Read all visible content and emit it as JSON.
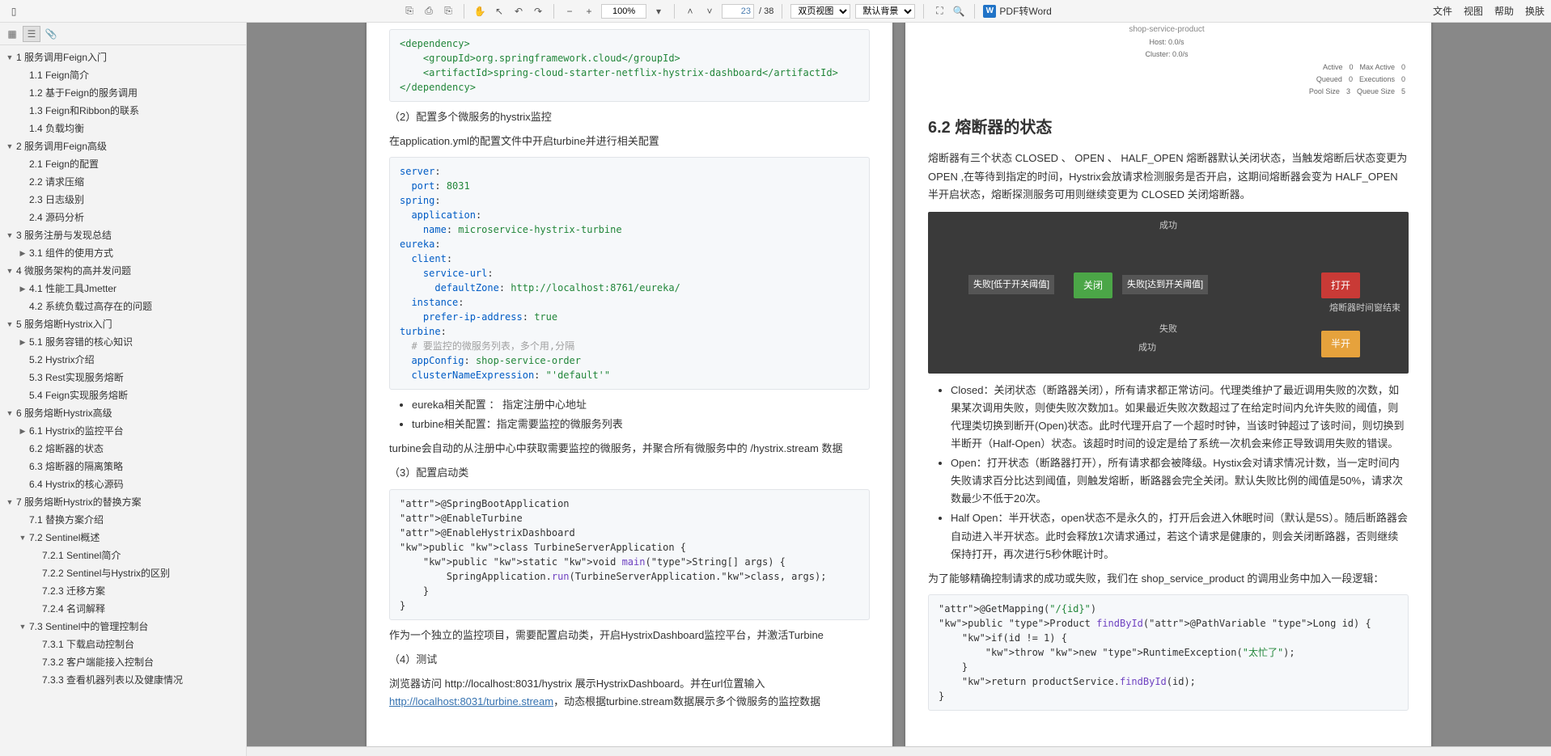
{
  "toolbar": {
    "page_current": "23",
    "page_total": "/ 38",
    "zoom": "100%",
    "spread_mode": "双页视图",
    "background_mode": "默认背景",
    "pdf_to_word": "PDF转Word",
    "pdf_icon": "W"
  },
  "menus": {
    "file": "文件",
    "view": "视图",
    "help": "帮助",
    "export": "换肤"
  },
  "outline": [
    {
      "lvl": 1,
      "toggle": "▼",
      "label": "1 服务调用Feign入门"
    },
    {
      "lvl": 2,
      "label": "1.1 Feign简介"
    },
    {
      "lvl": 2,
      "label": "1.2 基于Feign的服务调用"
    },
    {
      "lvl": 2,
      "label": "1.3 Feign和Ribbon的联系"
    },
    {
      "lvl": 2,
      "label": "1.4 负载均衡"
    },
    {
      "lvl": 1,
      "toggle": "▼",
      "label": "2 服务调用Feign高级"
    },
    {
      "lvl": 2,
      "label": "2.1 Feign的配置"
    },
    {
      "lvl": 2,
      "label": "2.2 请求压缩"
    },
    {
      "lvl": 2,
      "label": "2.3 日志级别"
    },
    {
      "lvl": 2,
      "label": "2.4 源码分析"
    },
    {
      "lvl": 1,
      "toggle": "▼",
      "label": "3 服务注册与发现总结"
    },
    {
      "lvl": 2,
      "toggle": "▶",
      "label": "3.1 组件的使用方式"
    },
    {
      "lvl": 1,
      "toggle": "▼",
      "label": "4 微服务架构的高并发问题"
    },
    {
      "lvl": 2,
      "toggle": "▶",
      "label": "4.1 性能工具Jmetter"
    },
    {
      "lvl": 2,
      "label": "4.2 系统负载过高存在的问题"
    },
    {
      "lvl": 1,
      "toggle": "▼",
      "label": "5 服务熔断Hystrix入门"
    },
    {
      "lvl": 2,
      "toggle": "▶",
      "label": "5.1 服务容错的核心知识"
    },
    {
      "lvl": 2,
      "label": "5.2 Hystrix介绍"
    },
    {
      "lvl": 2,
      "label": "5.3 Rest实现服务熔断"
    },
    {
      "lvl": 2,
      "label": "5.4 Feign实现服务熔断"
    },
    {
      "lvl": 1,
      "toggle": "▼",
      "label": "6 服务熔断Hystrix高级"
    },
    {
      "lvl": 2,
      "toggle": "▶",
      "label": "6.1 Hystrix的监控平台"
    },
    {
      "lvl": 2,
      "label": "6.2 熔断器的状态"
    },
    {
      "lvl": 2,
      "label": "6.3 熔断器的隔离策略"
    },
    {
      "lvl": 2,
      "label": "6.4 Hystrix的核心源码"
    },
    {
      "lvl": 1,
      "toggle": "▼",
      "label": "7 服务熔断Hystrix的替换方案"
    },
    {
      "lvl": 2,
      "label": "7.1 替换方案介绍"
    },
    {
      "lvl": 2,
      "toggle": "▼",
      "label": "7.2 Sentinel概述"
    },
    {
      "lvl": 3,
      "label": "7.2.1 Sentinel简介"
    },
    {
      "lvl": 3,
      "label": "7.2.2 Sentinel与Hystrix的区别"
    },
    {
      "lvl": 3,
      "label": "7.2.3 迁移方案"
    },
    {
      "lvl": 3,
      "label": "7.2.4 名词解释"
    },
    {
      "lvl": 2,
      "toggle": "▼",
      "label": "7.3 Sentinel中的管理控制台"
    },
    {
      "lvl": 3,
      "label": "7.3.1 下载启动控制台"
    },
    {
      "lvl": 3,
      "label": "7.3.2 客户端能接入控制台"
    },
    {
      "lvl": 3,
      "label": "7.3.3 查看机器列表以及健康情况"
    }
  ],
  "page_left": {
    "code1_lines": [
      {
        "t": "<dependency>",
        "c": "tag-b"
      },
      {
        "t": "    <groupId>org.springframework.cloud</groupId>",
        "c": "tag-b"
      },
      {
        "t": "    <artifactId>spring-cloud-starter-netflix-hystrix-dashboard</artifactId>",
        "c": "tag-b"
      },
      {
        "t": "</dependency>",
        "c": "tag-b"
      }
    ],
    "sec2": "（2）配置多个微服务的hystrix监控",
    "para2": "在application.yml的配置文件中开启turbine并进行相关配置",
    "code2": "server:\n  port: 8031\nspring:\n  application:\n    name: microservice-hystrix-turbine\neureka:\n  client:\n    service-url:\n      defaultZone: http://localhost:8761/eureka/\n  instance:\n    prefer-ip-address: true\nturbine:\n  # 要监控的微服务列表，多个用,分隔\n  appConfig: shop-service-order\n  clusterNameExpression: \"'default'\"",
    "bullets1": [
      "eureka相关配置 ： 指定注册中心地址",
      "turbine相关配置：指定需要监控的微服务列表"
    ],
    "para3": "turbine会自动的从注册中心中获取需要监控的微服务，并聚合所有微服务中的 /hystrix.stream 数据",
    "sec3": "（3）配置启动类",
    "code3": "@SpringBootApplication\n@EnableTurbine\n@EnableHystrixDashboard\npublic class TurbineServerApplication {\n    public static void main(String[] args) {\n        SpringApplication.run(TurbineServerApplication.class, args);\n    }\n}",
    "para4": "作为一个独立的监控项目，需要配置启动类，开启HystrixDashboard监控平台，并激活Turbine",
    "sec4": "（4）测试",
    "para5_a": "浏览器访问 http://localhost:8031/hystrix 展示HystrixDashboard。并在url位置输入 ",
    "para5_link": "http://localhost:8031/turbine.stream",
    "para5_b": "，动态根据turbine.stream数据展示多个微服务的监控数据"
  },
  "page_right": {
    "stats_title": "shop-service-product",
    "stats_host": "Host: 0.0/s",
    "stats_cluster": "Cluster: 0.0/s",
    "stats_rows": [
      [
        "Active",
        "0",
        "Max Active",
        "0"
      ],
      [
        "Queued",
        "0",
        "Executions",
        "0"
      ],
      [
        "Pool Size",
        "3",
        "Queue Size",
        "5"
      ]
    ],
    "h2": "6.2 熔断器的状态",
    "para1": "熔断器有三个状态 CLOSED 、 OPEN 、 HALF_OPEN 熔断器默认关闭状态，当触发熔断后状态变更为 OPEN ,在等待到指定的时间，Hystrix会放请求检测服务是否开启，这期间熔断器会变为 HALF_OPEN 半开启状态，熔断探测服务可用则继续变更为 CLOSED 关闭熔断器。",
    "diagram": {
      "success_top": "成功",
      "close": "关闭",
      "open": "打开",
      "half": "半开",
      "fail_low": "失败[低于开关阈值]",
      "fail_high": "失败[达到开关阈值]",
      "timeout": "熔断器时间窗结束",
      "fail": "失败",
      "success_bottom": "成功"
    },
    "bullets": [
      "Closed：关闭状态（断路器关闭），所有请求都正常访问。代理类维护了最近调用失败的次数，如果某次调用失败，则使失败次数加1。如果最近失败次数超过了在给定时间内允许失败的阈值，则代理类切换到断开(Open)状态。此时代理开启了一个超时时钟，当该时钟超过了该时间，则切换到半断开（Half-Open）状态。该超时时间的设定是给了系统一次机会来修正导致调用失败的错误。",
      "Open：打开状态（断路器打开），所有请求都会被降级。Hystix会对请求情况计数，当一定时间内失败请求百分比达到阈值，则触发熔断，断路器会完全关闭。默认失败比例的阈值是50%，请求次数最少不低于20次。",
      "Half Open：半开状态，open状态不是永久的，打开后会进入休眠时间（默认是5S）。随后断路器会自动进入半开状态。此时会释放1次请求通过，若这个请求是健康的，则会关闭断路器，否则继续保持打开，再次进行5秒休眠计时。"
    ],
    "para2": "为了能够精确控制请求的成功或失败，我们在 shop_service_product 的调用业务中加入一段逻辑：",
    "code1": "@GetMapping(\"/{id}\")\npublic Product findById(@PathVariable Long id) {\n    if(id != 1) {\n        throw new RuntimeException(\"太忙了\");\n    }\n    return productService.findById(id);\n}"
  }
}
